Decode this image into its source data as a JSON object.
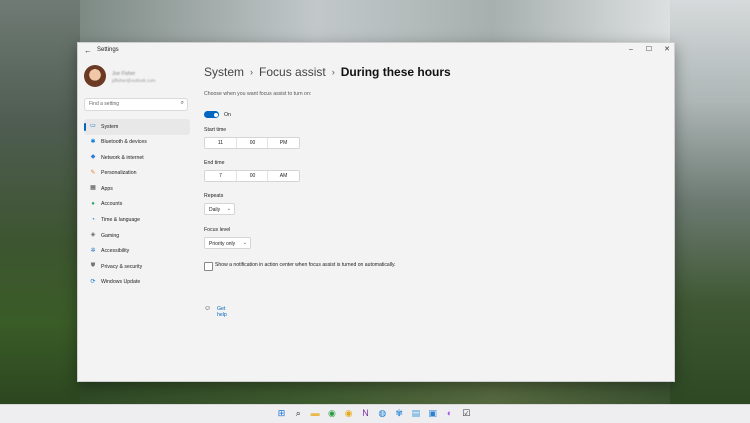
{
  "window": {
    "title": "Settings",
    "back_icon": "arrow-left-icon",
    "controls": {
      "minimize": "–",
      "maximize": "☐",
      "close": "✕"
    }
  },
  "profile": {
    "name": "Joe Fisher",
    "email": "jdfisher@outlook.com"
  },
  "search": {
    "placeholder": "Find a setting",
    "icon": "search-icon"
  },
  "sidebar": {
    "items": [
      {
        "label": "System",
        "icon": "monitor-icon",
        "glyph": "▭",
        "color": "#0067c0",
        "active": true
      },
      {
        "label": "Bluetooth & devices",
        "icon": "bluetooth-icon",
        "glyph": "✱",
        "color": "#0a7bd6",
        "active": false
      },
      {
        "label": "Network & internet",
        "icon": "wifi-icon",
        "glyph": "◆",
        "color": "#2b7cd3",
        "active": false
      },
      {
        "label": "Personalization",
        "icon": "brush-icon",
        "glyph": "✎",
        "color": "#e07a2e",
        "active": false
      },
      {
        "label": "Apps",
        "icon": "apps-icon",
        "glyph": "▦",
        "color": "#4a4a4a",
        "active": false
      },
      {
        "label": "Accounts",
        "icon": "person-icon",
        "glyph": "●",
        "color": "#2fa36b",
        "active": false
      },
      {
        "label": "Time & language",
        "icon": "globe-clock-icon",
        "glyph": "◔",
        "color": "#0a7bd6",
        "active": false
      },
      {
        "label": "Gaming",
        "icon": "gamepad-icon",
        "glyph": "◈",
        "color": "#666666",
        "active": false
      },
      {
        "label": "Accessibility",
        "icon": "accessibility-icon",
        "glyph": "✲",
        "color": "#1b6ec2",
        "active": false
      },
      {
        "label": "Privacy & security",
        "icon": "shield-icon",
        "glyph": "⛊",
        "color": "#777777",
        "active": false
      },
      {
        "label": "Windows Update",
        "icon": "update-icon",
        "glyph": "⟳",
        "color": "#0a7bd6",
        "active": false
      }
    ]
  },
  "breadcrumb": {
    "parts": [
      "System",
      "Focus assist"
    ],
    "current": "During these hours",
    "separator": "›"
  },
  "description": "Choose when you want focus assist to turn on:",
  "toggle": {
    "state": "On"
  },
  "start_time": {
    "label": "Start time",
    "hour": "11",
    "minute": "00",
    "period": "PM"
  },
  "end_time": {
    "label": "End time",
    "hour": "7",
    "minute": "00",
    "period": "AM"
  },
  "repeats": {
    "label": "Repeats",
    "value": "Daily"
  },
  "focus_level": {
    "label": "Focus level",
    "value": "Priority only"
  },
  "notification_checkbox": {
    "label": "Show a notification in action center when focus assist is turned on automatically.",
    "checked": false
  },
  "help": {
    "label": "Get help",
    "icon": "help-icon"
  },
  "taskbar": {
    "icons": [
      {
        "name": "start-icon",
        "glyph": "⊞",
        "color": "#1a73d9"
      },
      {
        "name": "search-icon",
        "glyph": "⌕",
        "color": "#222222"
      },
      {
        "name": "file-explorer-icon",
        "glyph": "▬",
        "color": "#e8b84a"
      },
      {
        "name": "chrome-icon",
        "glyph": "◉",
        "color": "#2e9e44"
      },
      {
        "name": "chrome-canary-icon",
        "glyph": "◉",
        "color": "#e6a817"
      },
      {
        "name": "onenote-icon",
        "glyph": "N",
        "color": "#7b2fa6"
      },
      {
        "name": "edge-icon",
        "glyph": "◍",
        "color": "#1c7fd6"
      },
      {
        "name": "paint-icon",
        "glyph": "✾",
        "color": "#3a8fd8"
      },
      {
        "name": "notepad-icon",
        "glyph": "▤",
        "color": "#3a9ad9"
      },
      {
        "name": "photos-icon",
        "glyph": "▣",
        "color": "#2d7fd0"
      },
      {
        "name": "messenger-icon",
        "glyph": "◐",
        "color": "#a256e6"
      },
      {
        "name": "todo-icon",
        "glyph": "☑",
        "color": "#333333"
      }
    ]
  }
}
